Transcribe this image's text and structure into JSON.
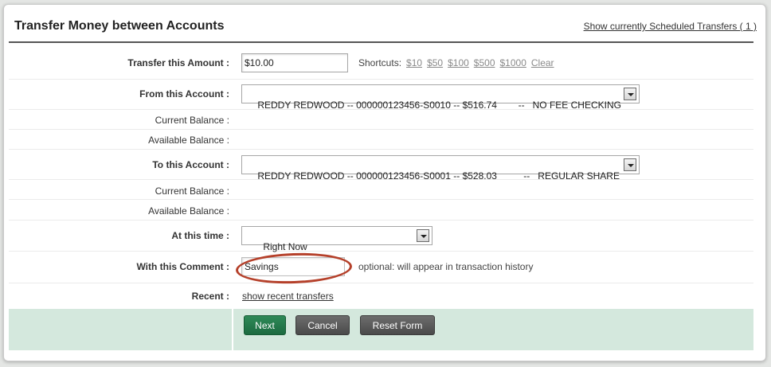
{
  "header": {
    "title": "Transfer Money between Accounts",
    "scheduled_link": "Show currently Scheduled Transfers ( 1 )"
  },
  "amount": {
    "label": "Transfer this Amount :",
    "value": "$10.00",
    "shortcuts_label": "Shortcuts:",
    "shortcuts": [
      "$10",
      "$50",
      "$100",
      "$500",
      "$1000"
    ],
    "clear": "Clear"
  },
  "from": {
    "label": "From this Account :",
    "selected": "REDDY REDWOOD -- 000000123456-S0010 -- $516.74        --   NO FEE CHECKING",
    "current_balance_label": "Current Balance :",
    "available_balance_label": "Available Balance :"
  },
  "to": {
    "label": "To this Account :",
    "selected": "REDDY REDWOOD -- 000000123456-S0001 -- $528.03          --   REGULAR SHARE",
    "current_balance_label": "Current Balance :",
    "available_balance_label": "Available Balance :"
  },
  "time": {
    "label": "At this time :",
    "selected": "Right Now"
  },
  "comment": {
    "label": "With this Comment :",
    "value": "Savings",
    "hint": "optional: will appear in transaction history"
  },
  "recent": {
    "label": "Recent :",
    "link": "show recent transfers"
  },
  "buttons": {
    "next": "Next",
    "cancel": "Cancel",
    "reset": "Reset Form"
  },
  "colors": {
    "accent_green": "#1c6a40",
    "footer_bg": "#d4e8dd",
    "highlight": "#b5402a"
  }
}
